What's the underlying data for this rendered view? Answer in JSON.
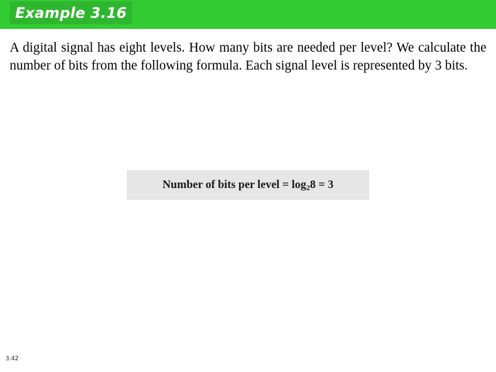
{
  "slide": {
    "title": "Example 3.16",
    "body": "A digital signal has eight levels. How many bits are needed per level? We calculate the number of bits from the following formula. Each signal level is represented by 3 bits.",
    "formula": {
      "prefix": "Number of bits per level = log",
      "subscript": "2",
      "suffix": "8 = 3"
    },
    "page_number": "3.42",
    "colors": {
      "title_band": "#33cc33",
      "title_plate": "#2fb62f",
      "title_text": "#ffffff",
      "formula_box": "#e6e6e6",
      "body_text": "#000000"
    }
  }
}
